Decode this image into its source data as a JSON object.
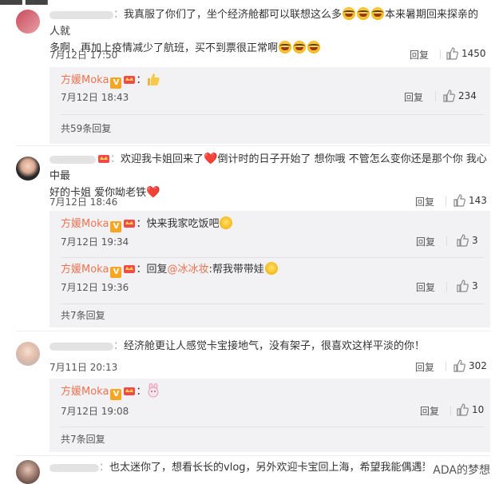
{
  "comments": [
    {
      "text": "我真服了你们了，坐个经济舱都可以联想这么多",
      "text_tail": "本来暑期回来探亲的人就",
      "text_line2": "多啊，再加上疫情减少了航班，买不到票很正常啊",
      "time": "7月12日 17:50",
      "reply_label": "回复",
      "likes": "1450",
      "replies": [
        {
          "name": "方媛Moka",
          "v_badge": "V",
          "text": "",
          "time": "7月12日 18:43",
          "reply_label": "回复",
          "likes": "234"
        }
      ],
      "more_label": "共59条回复"
    },
    {
      "text": "欢迎我卡姐回来了",
      "text_mid": "倒计时的日子开始了 想你哦 不管怎么变你还是那个你 我心中最",
      "text_line2": "好的卡姐 爱你呦老铁",
      "time": "7月12日 18:46",
      "reply_label": "回复",
      "likes": "143",
      "replies": [
        {
          "name": "方媛Moka",
          "v_badge": "V",
          "text": "快来我家吃饭吧",
          "time": "7月12日 19:34",
          "reply_label": "回复",
          "likes": "3"
        },
        {
          "name": "方媛Moka",
          "v_badge": "V",
          "text_prefix": "回复",
          "mention": "@冰冰妆",
          "text": ":帮我带带娃",
          "time": "7月12日 19:36",
          "reply_label": "回复",
          "likes": "3"
        }
      ],
      "more_label": "共7条回复"
    },
    {
      "text": "经济舱更让人感觉卡宝接地气，没有架子，很喜欢这样平淡的你！",
      "time": "7月11日 20:13",
      "reply_label": "回复",
      "likes": "302",
      "replies": [
        {
          "name": "方媛Moka",
          "v_badge": "V",
          "text": "",
          "time": "7月12日 19:08",
          "reply_label": "回复",
          "likes": "10"
        }
      ],
      "more_label": "共7条回复"
    },
    {
      "text": "也太迷你了，想看长长的vlog，另外欢迎卡宝回上海，希望我能偶遇到"
    }
  ],
  "watermark": "ADA的梦想",
  "icons": {
    "like": "thumbs-up-icon",
    "heart": "heart-icon",
    "emoji": "laugh-emoji-icon"
  },
  "colors": {
    "username": "#eb7350",
    "reply_bg": "#f2f2f5",
    "v_badge": "#f6a623"
  }
}
